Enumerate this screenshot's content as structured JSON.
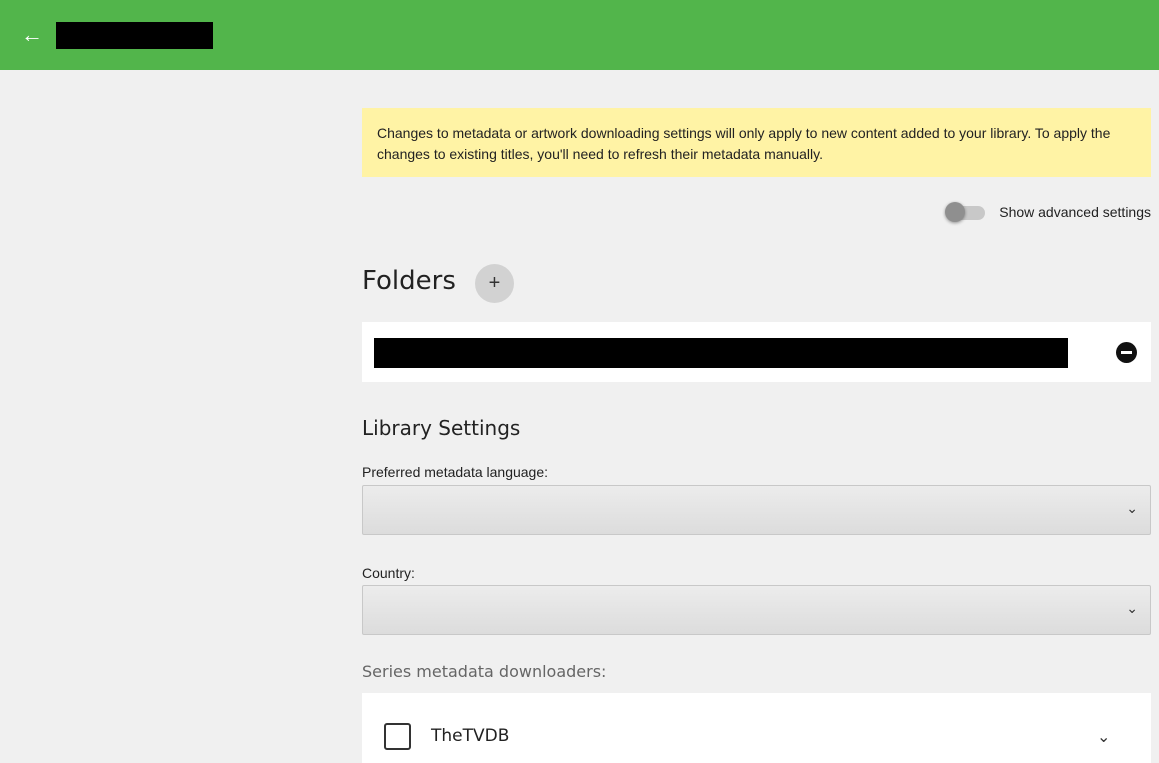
{
  "header": {
    "back_icon": "arrow-left-icon"
  },
  "notice": {
    "text": "Changes to metadata or artwork downloading settings will only apply to new content added to your library. To apply the changes to existing titles, you'll need to refresh their metadata manually."
  },
  "advanced": {
    "label": "Show advanced settings",
    "enabled": false
  },
  "folders": {
    "title": "Folders",
    "add_label": "+"
  },
  "library_settings": {
    "title": "Library Settings",
    "language_label": "Preferred metadata language:",
    "country_label": "Country:",
    "chevron": "⌄"
  },
  "series_downloaders": {
    "label": "Series metadata downloaders:",
    "items": [
      {
        "name": "TheTVDB",
        "checked": false
      }
    ],
    "chevron": "⌄"
  }
}
